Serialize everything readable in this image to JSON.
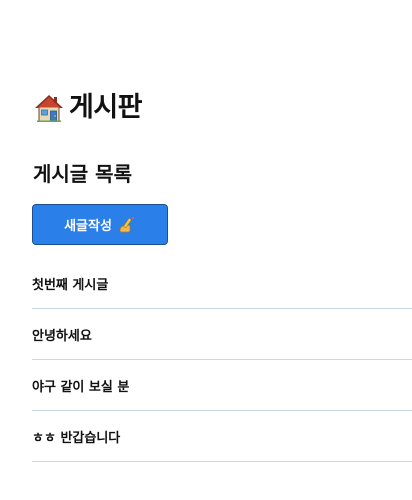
{
  "header": {
    "title": "게시판",
    "icon": "house-icon"
  },
  "board": {
    "section_title": "게시글 목록",
    "write_button_label": "새글작성",
    "write_button_icon": "pencil-icon",
    "posts": [
      {
        "title": "첫번째 게시글"
      },
      {
        "title": "안녕하세요"
      },
      {
        "title": "야구 같이 보실 분"
      },
      {
        "title": "ㅎㅎ 반갑습니다"
      }
    ]
  },
  "colors": {
    "button_bg": "#2a7fe8",
    "divider": "#c7d9e8"
  }
}
